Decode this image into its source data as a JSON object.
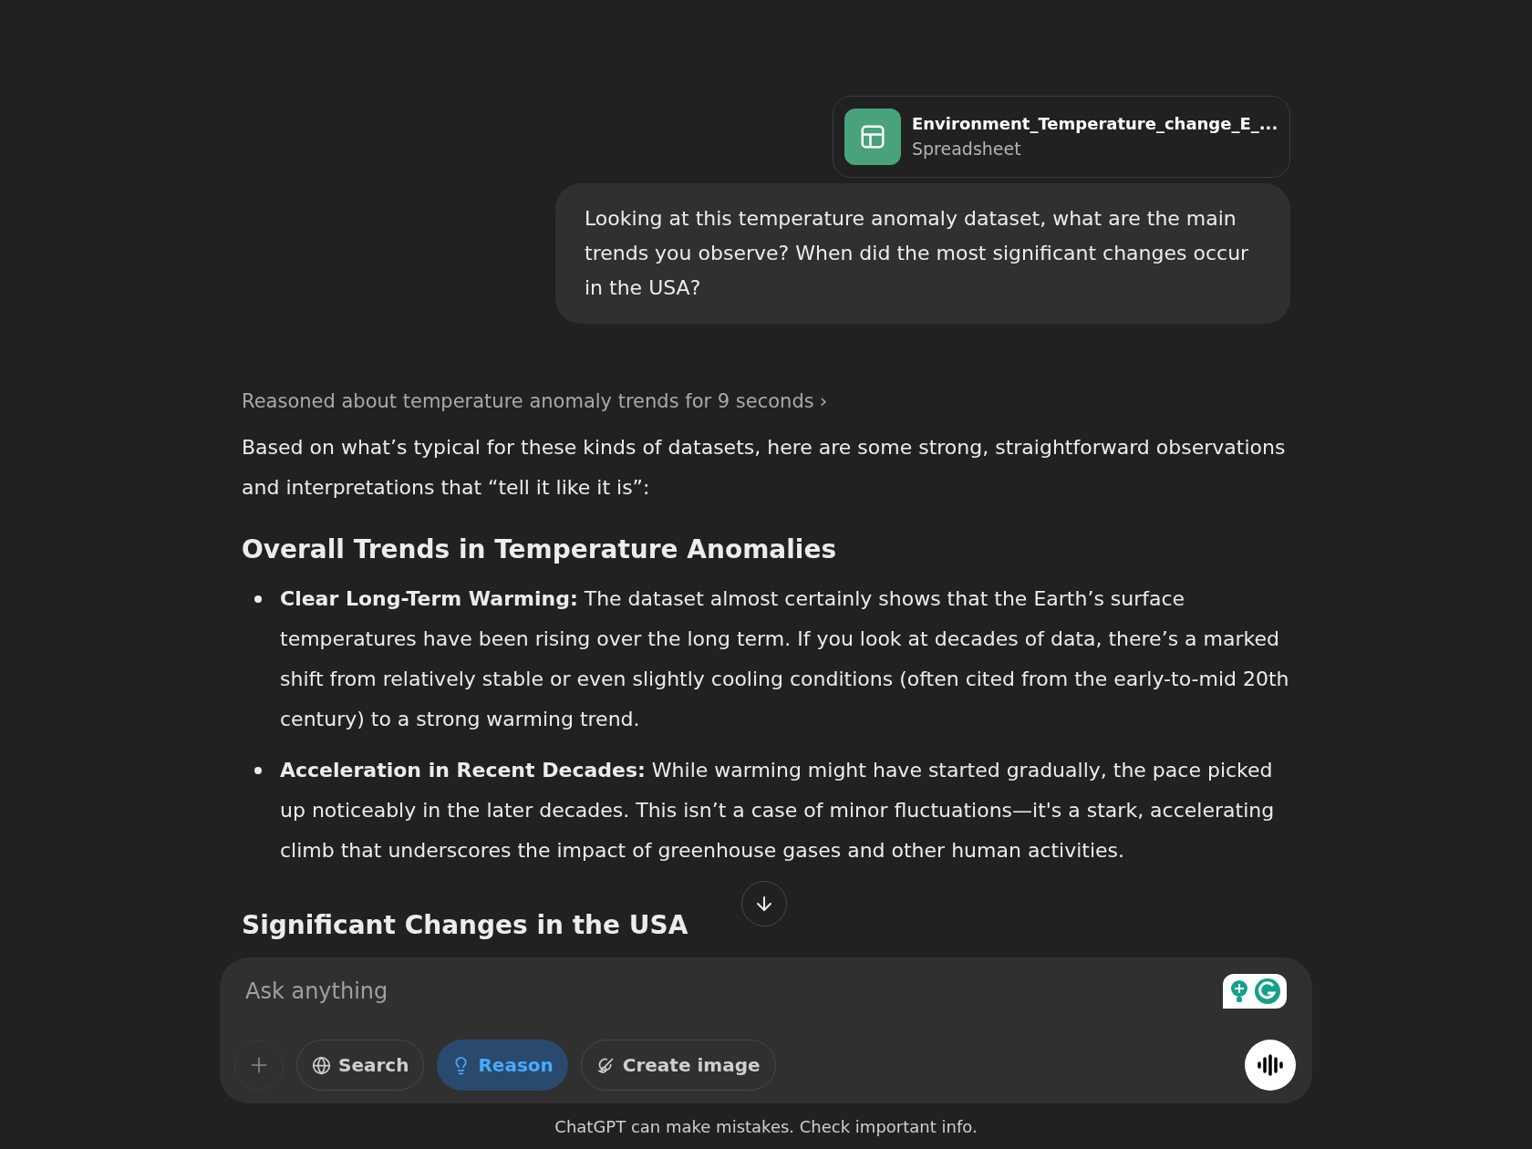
{
  "attachment": {
    "name": "Environment_Temperature_change_E_...",
    "type": "Spreadsheet"
  },
  "user_message": "Looking at this temperature anomaly dataset, what are the main trends you observe? When did the most significant changes occur in the USA?",
  "reasoning": {
    "label": "Reasoned about temperature anomaly trends for 9 seconds",
    "chevron": "›"
  },
  "intro": "Based on what’s typical for these kinds of datasets, here are some strong, straightforward observations and interpretations that “tell it like it is”:",
  "sections": [
    {
      "heading": "Overall Trends in Temperature Anomalies",
      "bullets": [
        "**Clear Long-Term Warming:** The dataset almost certainly shows that the Earth’s surface temperatures have been rising over the long term. If you look at decades of data, there’s a marked shift from relatively stable or even slightly cooling conditions (often cited from the early-to-mid 20th century) to a strong warming trend.",
        "**Acceleration in Recent Decades:** While warming might have started gradually, the pace picked up noticeably in the later decades. This isn’t a case of minor fluctuations—it's a stark, accelerating climb that underscores the impact of greenhouse gases and other human activities."
      ]
    },
    {
      "heading": "Significant Changes in the USA"
    }
  ],
  "composer": {
    "placeholder": "Ask anything",
    "tools": [
      {
        "kind": "plus"
      },
      {
        "kind": "search",
        "label": "Search",
        "selected": false
      },
      {
        "kind": "reason",
        "label": "Reason",
        "selected": true
      },
      {
        "kind": "image",
        "label": "Create image",
        "selected": false
      }
    ]
  },
  "disclaimer": "ChatGPT can make mistakes. Check important info."
}
